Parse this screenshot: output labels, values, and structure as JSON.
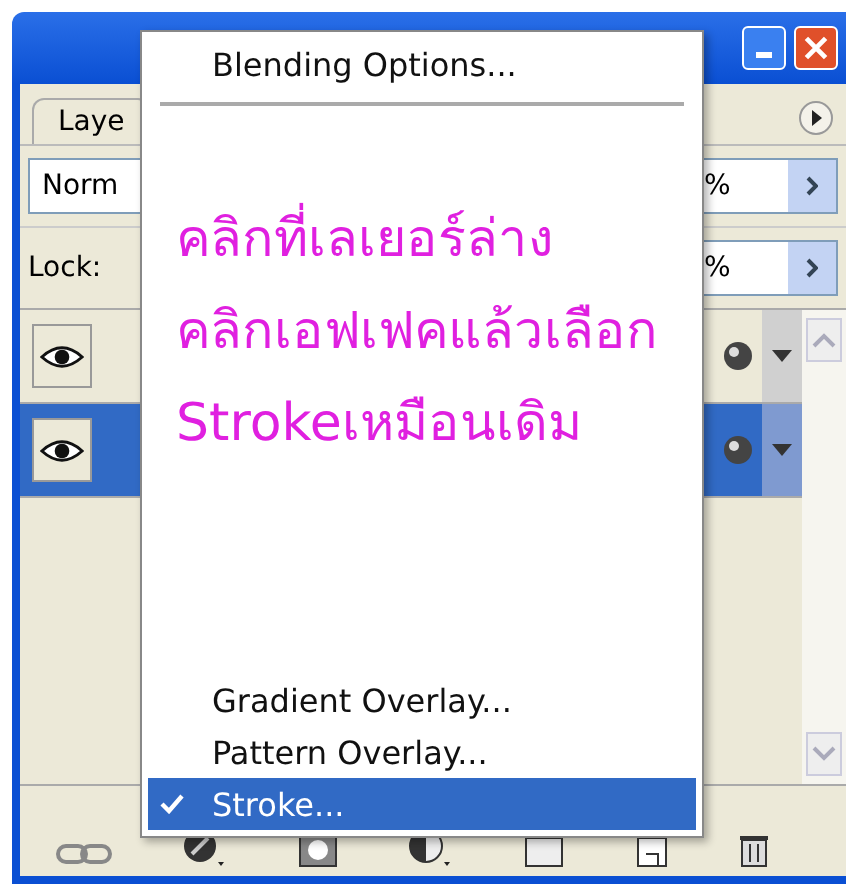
{
  "panel": {
    "tab": {
      "label": "Laye",
      "selected": true
    },
    "blend_mode": "Norm",
    "opacity": "%",
    "lock_label": "Lock:",
    "fill": "%"
  },
  "layers": [
    {
      "visible": true,
      "selected": false
    },
    {
      "visible": true,
      "selected": true
    }
  ],
  "context_menu": {
    "items": [
      {
        "kind": "item",
        "label": "Blending Options...",
        "checked": false,
        "selected": false
      },
      {
        "kind": "separator"
      },
      {
        "kind": "note",
        "lines": [
          "คลิกที่เลเยอร์ล่าง",
          "คลิกเอฟเฟคแล้วเลือก",
          "Strokeเหมือนเดิม"
        ]
      },
      {
        "kind": "item",
        "label": "Gradient Overlay...",
        "checked": false,
        "selected": false
      },
      {
        "kind": "item",
        "label": "Pattern Overlay...",
        "checked": false,
        "selected": false
      },
      {
        "kind": "item",
        "label": "Stroke...",
        "checked": true,
        "selected": true
      }
    ]
  }
}
